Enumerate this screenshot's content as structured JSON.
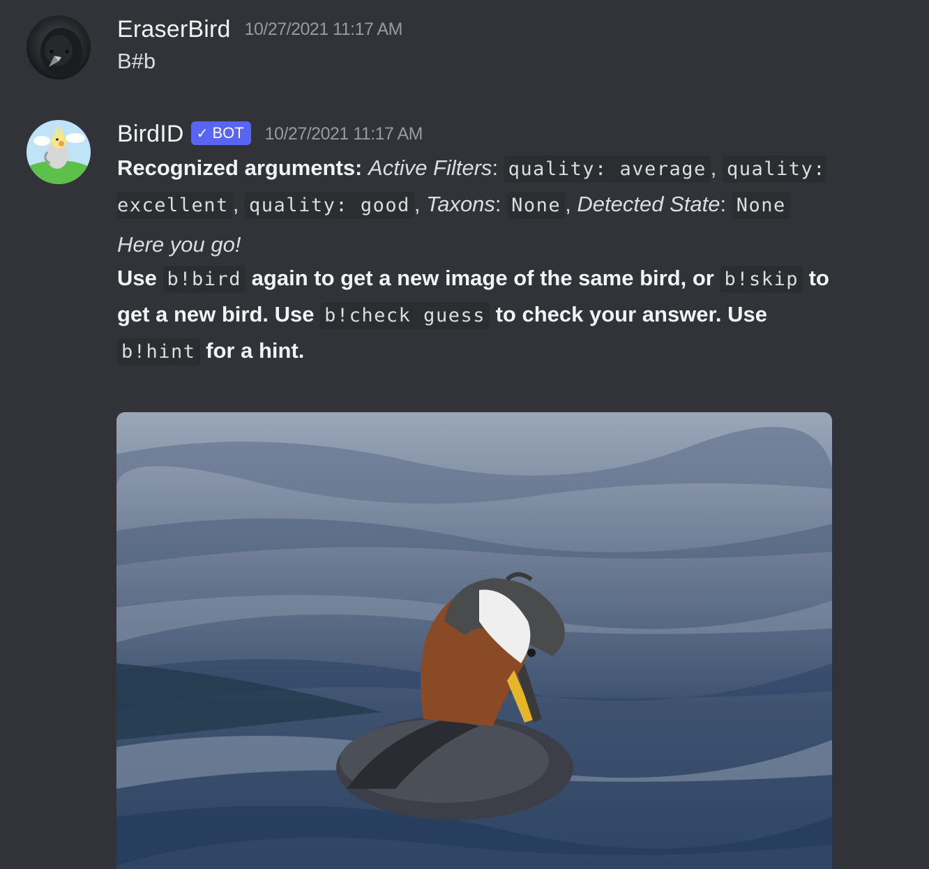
{
  "messages": [
    {
      "username": "EraserBird",
      "timestamp": "10/27/2021 11:17 AM",
      "content": "B#b"
    },
    {
      "username": "BirdID",
      "bot_tag": "BOT",
      "timestamp": "10/27/2021 11:17 AM",
      "args": {
        "label": "Recognized arguments:",
        "active_filters_label": "Active Filters",
        "filter_1": "quality: average",
        "filter_2": "quality: excellent",
        "filter_3": "quality: good",
        "taxons_label": "Taxons",
        "taxons_value": "None",
        "detected_state_label": "Detected State",
        "detected_state_value": "None"
      },
      "here_you_go": "Here you go!",
      "instructions": {
        "part_1": "Use",
        "cmd_bird": "b!bird",
        "part_2": "again to get a new image of the same bird, or",
        "cmd_skip": "b!skip",
        "part_3": "to get a new bird. Use",
        "cmd_check": "b!check guess",
        "part_4": "to check your answer. Use",
        "cmd_hint": "b!hint",
        "part_5": "for a hint."
      }
    }
  ],
  "colors": {
    "background": "#313338",
    "bot_tag": "#5865f2",
    "code_bg": "#2b2d31",
    "timestamp": "#949ba4"
  }
}
